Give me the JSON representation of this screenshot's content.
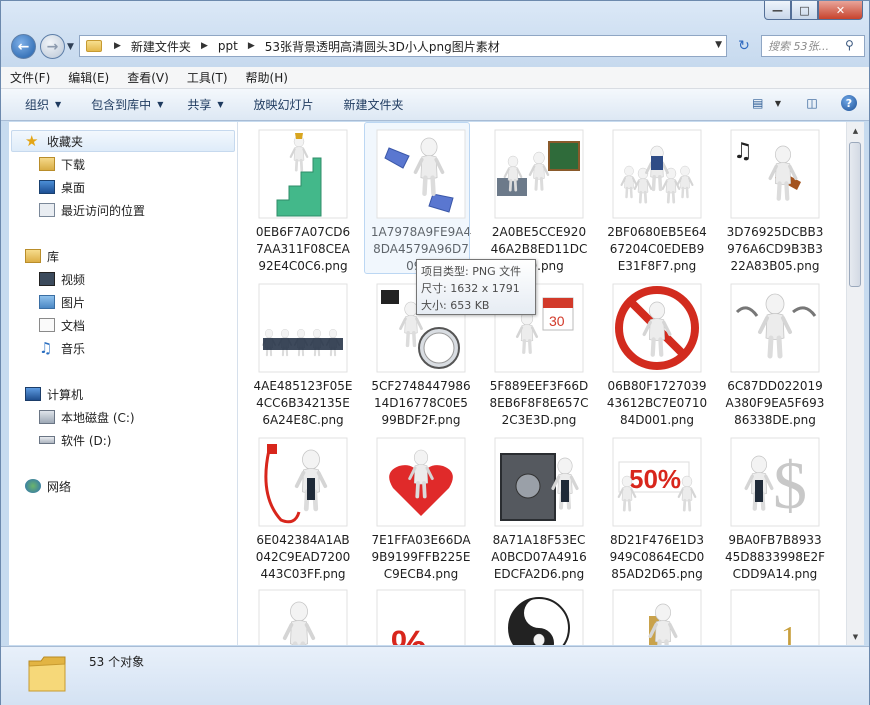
{
  "window": {
    "caption_buttons": [
      "minimize",
      "maximize",
      "close"
    ]
  },
  "nav": {
    "breadcrumbs": [
      "新建文件夹",
      "ppt",
      "53张背景透明高清圆头3D小人png图片素材"
    ],
    "search_placeholder": "搜索 53张..."
  },
  "menu": [
    "文件(F)",
    "编辑(E)",
    "查看(V)",
    "工具(T)",
    "帮助(H)"
  ],
  "commands": {
    "organize": "组织",
    "include_library": "包含到库中",
    "share": "共享",
    "slideshow": "放映幻灯片",
    "new_folder": "新建文件夹"
  },
  "sidebar": {
    "favorites": {
      "label": "收藏夹",
      "items": [
        "下载",
        "桌面",
        "最近访问的位置"
      ]
    },
    "libraries": {
      "label": "库",
      "items": [
        "视频",
        "图片",
        "文档",
        "音乐"
      ]
    },
    "computer": {
      "label": "计算机",
      "items": [
        "本地磁盘 (C:)",
        "软件 (D:)"
      ]
    },
    "network": {
      "label": "网络"
    }
  },
  "files": [
    {
      "name": "0EB6F7A07CD67AA311F08CEA92E4C0C6.png",
      "lines": [
        "0EB6F7A07CD6",
        "7AA311F08CEA",
        "92E4C0C6.png"
      ],
      "icon": "figure-stairs-trophy-icon"
    },
    {
      "name": "1A7978A9FE9A48DA4579A96D7092F....png",
      "lines": [
        "1A7978A9FE9A4",
        "8DA4579A96D7",
        "092F"
      ],
      "icon": "figure-rollerskate-icon"
    },
    {
      "name": "2A0BE5CCE92046A2B8ED11DC609.png",
      "lines": [
        "2A0BE5CCE920",
        "46A2B8ED11DC",
        "609.png"
      ],
      "icon": "figure-classroom-icon"
    },
    {
      "name": "2BF0680EB5E6467204C0EDEB9E31F8F7.png",
      "lines": [
        "2BF0680EB5E64",
        "67204C0EDEB9",
        "E31F8F7.png"
      ],
      "icon": "figure-group-leader-icon"
    },
    {
      "name": "3D76925DCBB3976A6CD9B3B322A83B05.png",
      "lines": [
        "3D76925DCBB3",
        "976A6CD9B3B3",
        "22A83B05.png"
      ],
      "icon": "figure-violin-icon"
    },
    {
      "name": "4AE485123F05E4CC6B342135E6A24E8C.png",
      "lines": [
        "4AE485123F05E",
        "4CC6B342135E",
        "6A24E8C.png"
      ],
      "icon": "figure-business-team-icon"
    },
    {
      "name": "5CF2748447986 14D16778C0E599BDF2F.png",
      "lines": [
        "5CF2748447986",
        "14D16778C0E5",
        "99BDF2F.png"
      ],
      "icon": "figure-stopwatch-icon"
    },
    {
      "name": "5F889EEF3F66D8EB6F8F8E657C2C3E3D.png",
      "lines": [
        "5F889EEF3F66D",
        "8EB6F8F8E657C",
        "2C3E3D.png"
      ],
      "icon": "figure-calendar-icon"
    },
    {
      "name": "06B80F172703943612BC7E071084D001.png",
      "lines": [
        "06B80F1727039",
        "43612BC7E0710",
        "84D001.png"
      ],
      "icon": "figure-prohibited-icon"
    },
    {
      "name": "6C87DD022019A380F9EA5F69386338DE.png",
      "lines": [
        "6C87DD022019",
        "A380F9EA5F693",
        "86338DE.png"
      ],
      "icon": "figure-chains-icon"
    },
    {
      "name": "6E042384A1AB042C9EAD7200443C03FF.png",
      "lines": [
        "6E042384A1AB",
        "042C9EAD7200",
        "443C03FF.png"
      ],
      "icon": "figure-cable-icon"
    },
    {
      "name": "7E1FFA03E66DA9B9199FFB225EC9ECB4.png",
      "lines": [
        "7E1FFA03E66DA",
        "9B9199FFB225E",
        "C9ECB4.png"
      ],
      "icon": "figure-heart-icon"
    },
    {
      "name": "8A71A18F53ECA0BCD07A4916EDCFA2D6.png",
      "lines": [
        "8A71A18F53EC",
        "A0BCD07A4916",
        "EDCFA2D6.png"
      ],
      "icon": "figure-safe-icon"
    },
    {
      "name": "8D21F476E1D3949C0864ECD085AD2D65.png",
      "lines": [
        "8D21F476E1D3",
        "949C0864ECD0",
        "85AD2D65.png"
      ],
      "icon": "figure-percent-sign-icon"
    },
    {
      "name": "9BA0FB7B893345D8833998E2FCDD9A14.png",
      "lines": [
        "9BA0FB7B8933",
        "45D8833998E2F",
        "CDD9A14.png"
      ],
      "icon": "figure-dollar-icon"
    }
  ],
  "partial_row_icons": [
    "figure-thinking-icon",
    "figure-percent-red-icon",
    "figure-yinyang-icon",
    "figure-keyhole-icon",
    "figure-numbers-icon"
  ],
  "tooltip": {
    "type": "项目类型: PNG 文件",
    "size": "尺寸: 1632 x 1791",
    "filesize": "大小: 653 KB"
  },
  "status": {
    "count": "53 个对象"
  }
}
